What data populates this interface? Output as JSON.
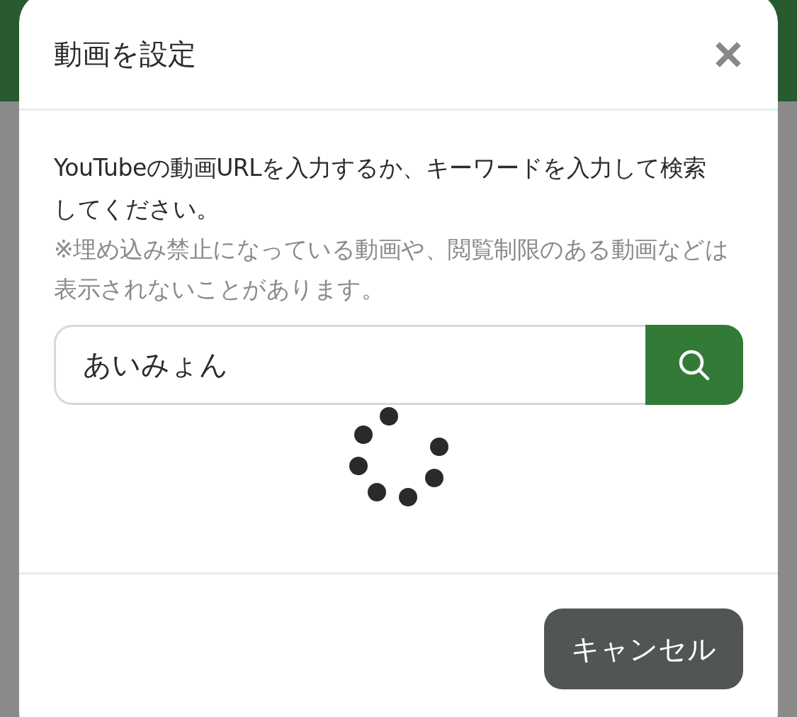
{
  "dialog": {
    "title": "動画を設定",
    "description": "YouTubeの動画URLを入力するか、キーワードを入力して検索してください。",
    "note": "※埋め込み禁止になっている動画や、閲覧制限のある動画などは表示されないことがあります。",
    "search": {
      "value": "あいみょん"
    },
    "loading": true,
    "buttons": [
      {
        "label": "キャンセル",
        "kind": "cancel"
      }
    ]
  }
}
